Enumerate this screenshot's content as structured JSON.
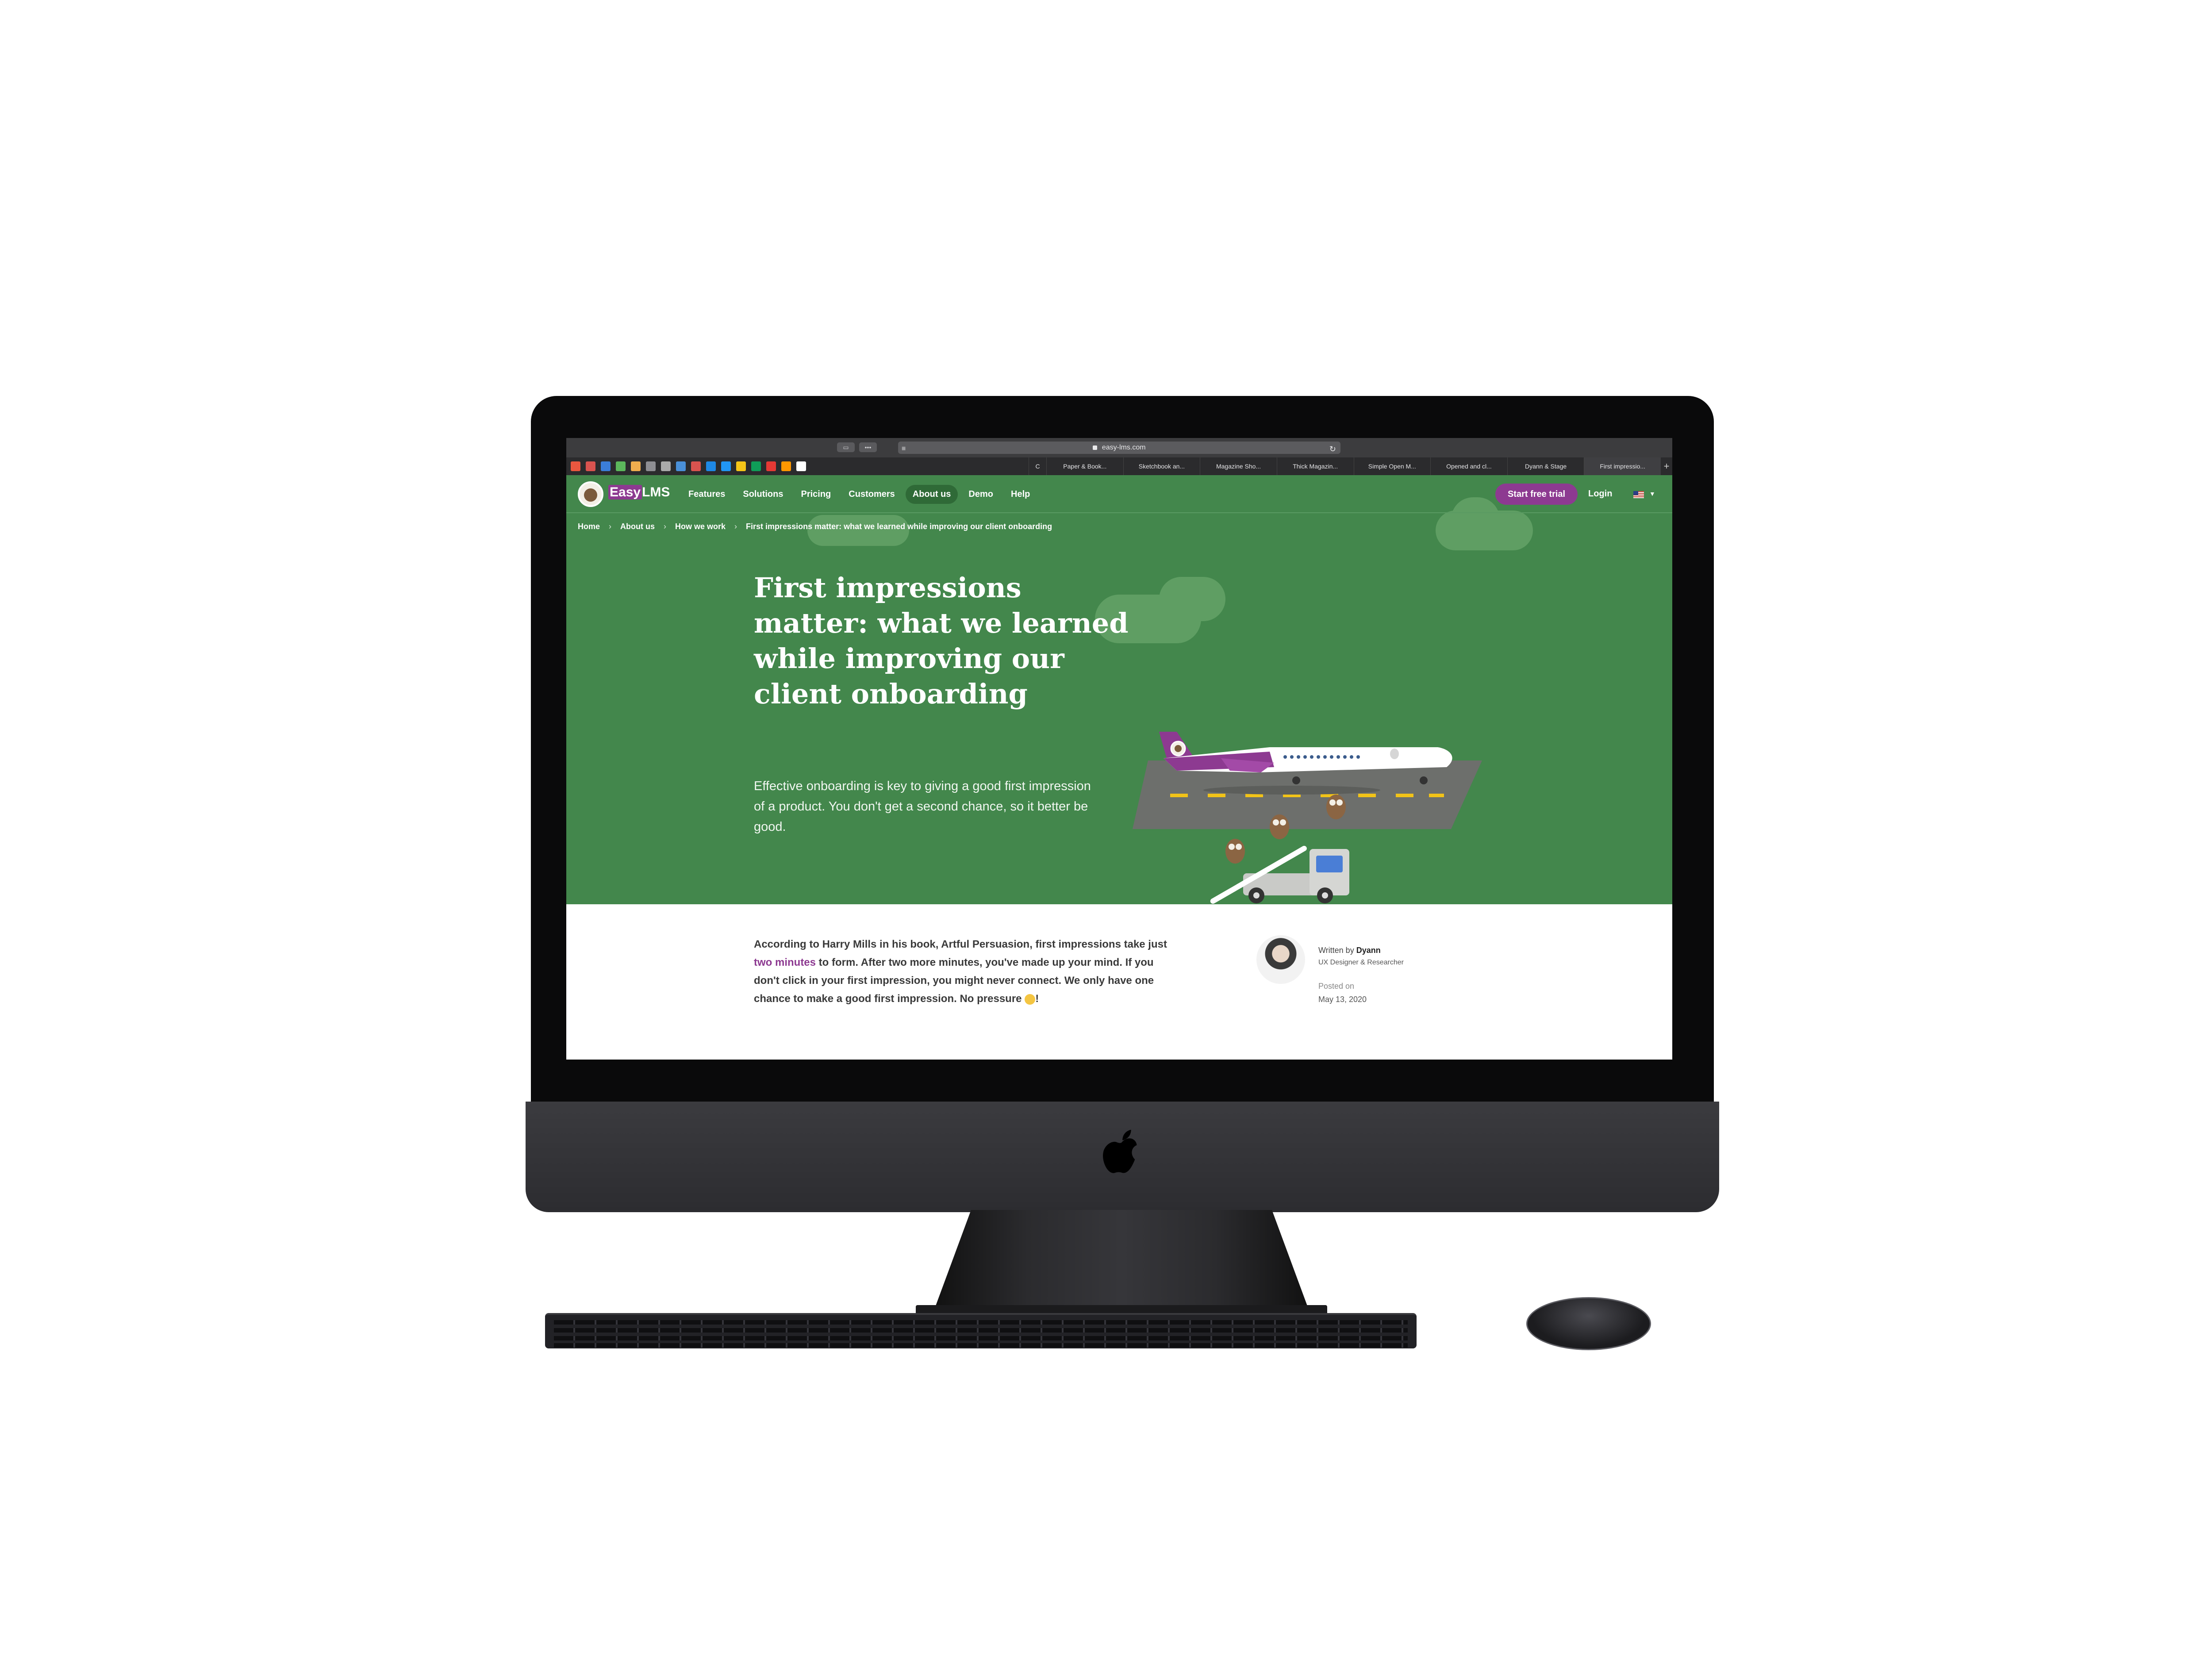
{
  "browser": {
    "url": "easy-lms.com",
    "tabs": [
      "C",
      "Paper & Book...",
      "Sketchbook an...",
      "Magazine Sho...",
      "Thick Magazin...",
      "Simple Open M...",
      "Opened and cl...",
      "Dyann & Stage",
      "First impressio..."
    ],
    "favicon_colors": [
      "#e9573f",
      "#d9534f",
      "#3b7dd8",
      "#5cb85c",
      "#f0ad4e",
      "#8e8e93",
      "#aaaaaa",
      "#4a90d9",
      "#d9534f",
      "#1e88e5",
      "#2196f3",
      "#f5c518",
      "#0f9d58",
      "#e53935",
      "#ff9800",
      "#ffffff"
    ]
  },
  "nav": {
    "logo_text_easy": "Easy",
    "logo_text_lms": "LMS",
    "items": [
      "Features",
      "Solutions",
      "Pricing",
      "Customers",
      "About us",
      "Demo",
      "Help"
    ],
    "active_item": "About us",
    "cta_label": "Start free trial",
    "login_label": "Login"
  },
  "breadcrumb": [
    "Home",
    "About us",
    "How we work",
    "First impressions matter: what we learned while improving our client onboarding"
  ],
  "hero": {
    "title": "First impressions matter: what we learned while improving our client onboarding",
    "subtitle": "Effective onboarding is key to giving a good first impression of a product. You don't get a second chance, so it better be good."
  },
  "article": {
    "text_before_link": "According to Harry Mills in his book, Artful Persuasion, first impressions take just ",
    "link_text": "two minutes",
    "text_after_link": " to form. After two more minutes, you've made up your mind. If you don't click in your first impression, you might never connect. We only have one chance to make a good first impression. No pressure ",
    "text_end": "!"
  },
  "author": {
    "written_by_label": "Written by",
    "name": "Dyann",
    "role": "UX Designer & Researcher",
    "posted_label": "Posted on",
    "date": "May 13, 2020"
  },
  "colors": {
    "hero_green": "#43874c",
    "brand_purple": "#8d3a91",
    "nav_active": "#2f6a37"
  }
}
